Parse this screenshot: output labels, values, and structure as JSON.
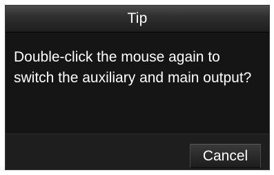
{
  "dialog": {
    "title": "Tip",
    "message_lines": [
      "Double-click the mouse again to",
      "switch the auxiliary and main output?"
    ],
    "cancel_label": "Cancel"
  },
  "colors": {
    "dialog_background": "#151515",
    "footer_background": "#1e1e1e",
    "text": "#ffffff"
  }
}
